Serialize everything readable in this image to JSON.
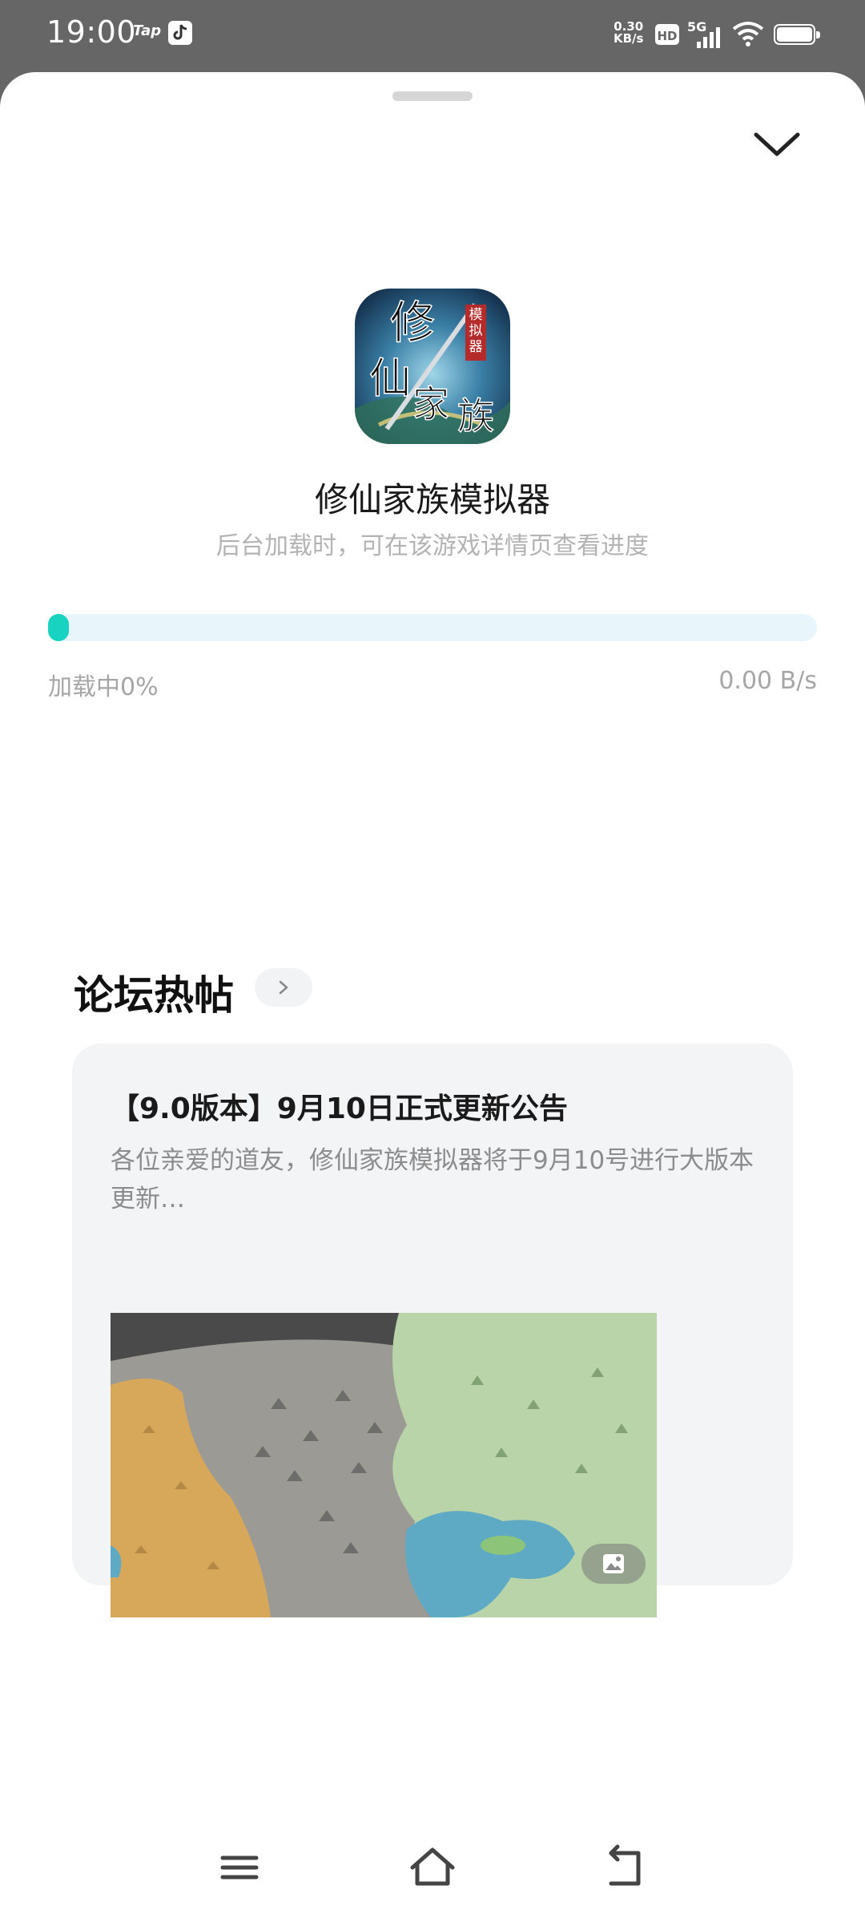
{
  "status_bar": {
    "time": "19:00",
    "tap_label": "Tap",
    "net_speed_value": "0.30",
    "net_speed_unit": "KB/s",
    "hd_label": "HD",
    "network_label": "5G"
  },
  "header": {
    "collapse_icon": "chevron-down-icon"
  },
  "app": {
    "name": "修仙家族模拟器",
    "hint": "后台加载时，可在该游戏详情页查看进度",
    "icon_text": "修仙家族",
    "icon_badge": "模拟器"
  },
  "download": {
    "status_label": "加载中0%",
    "progress_fraction": 0.0,
    "speed": "0.00 B/s",
    "accent_color": "#17d3c0"
  },
  "forum": {
    "section_title": "论坛热帖",
    "more_icon": "chevron-right-icon",
    "posts": [
      {
        "title": "【9.0版本】9月10日正式更新公告",
        "excerpt": "各位亲爱的道友，修仙家族模拟器将于9月10号进行大版本更新…",
        "image_badge_icon": "image-icon"
      }
    ]
  },
  "nav_bar": {
    "menu_icon": "menu-icon",
    "home_icon": "home-icon",
    "back_icon": "back-icon"
  }
}
